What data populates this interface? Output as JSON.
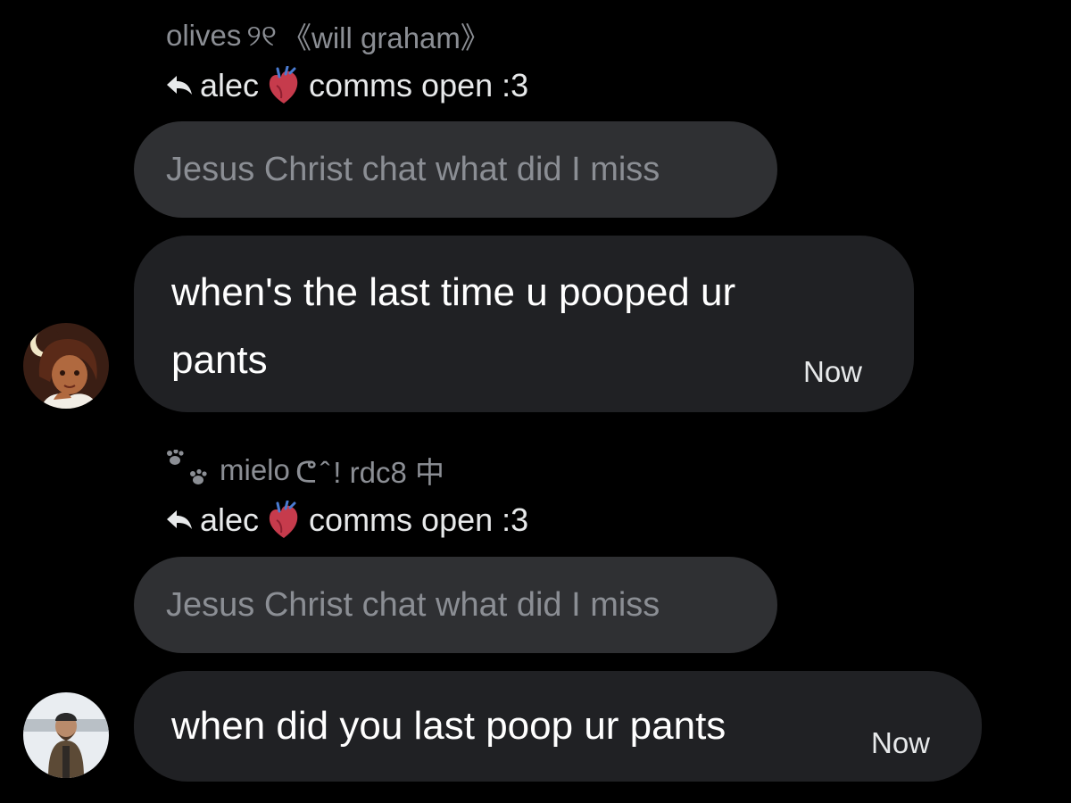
{
  "thread": [
    {
      "sender_name": "olives",
      "sender_glyph": "୨୧",
      "sender_suffix": "《will graham》",
      "reply_to_name": "alec",
      "reply_to_rest": "comms open :3",
      "reply_icon": "heart-anatomical-icon",
      "quoted_text": "Jesus Christ chat what did I miss",
      "message_line1": "when's the last time u pooped ur",
      "message_line2": "pants",
      "time": "Now",
      "avatar": "cartoon-girl-avatar"
    },
    {
      "sender_icon": "paw-prints-icon",
      "sender_name": "mielo",
      "sender_glyph": "ᕦ ̂ ! rdc8 中",
      "reply_to_name": "alec",
      "reply_to_rest": "comms open :3",
      "reply_icon": "heart-anatomical-icon",
      "quoted_text": "Jesus Christ chat what did I miss",
      "message": "when did you last poop ur pants",
      "time": "Now",
      "avatar": "man-in-snow-avatar"
    }
  ],
  "colors": {
    "background": "#000000",
    "bubble": "#202124",
    "quoted_bubble": "#2f3033",
    "muted_text": "#8b8e94"
  }
}
